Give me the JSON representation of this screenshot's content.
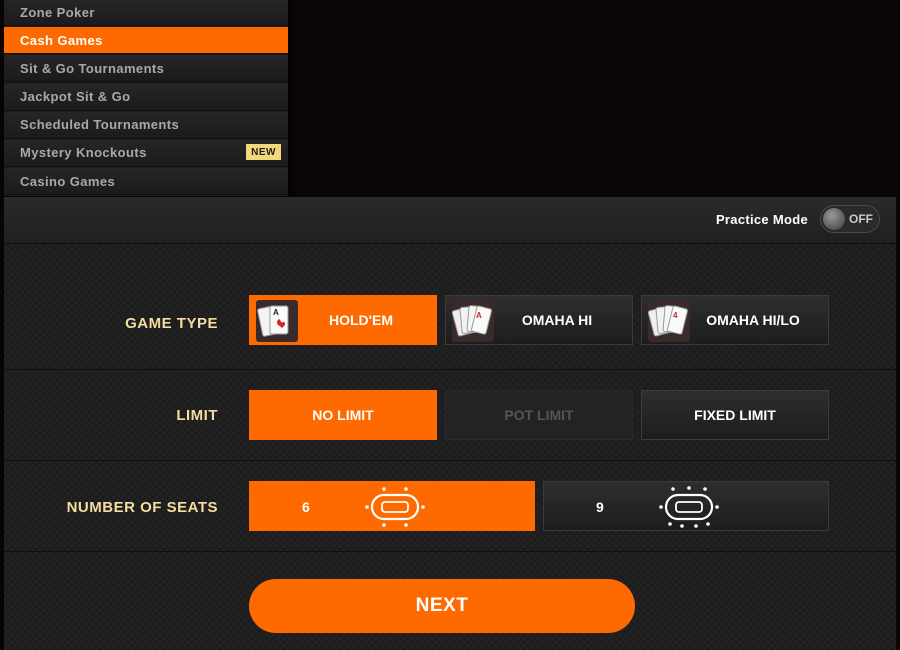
{
  "menu": {
    "items": [
      {
        "label": "Zone Poker"
      },
      {
        "label": "Cash Games"
      },
      {
        "label": "Sit & Go Tournaments"
      },
      {
        "label": "Jackpot Sit & Go"
      },
      {
        "label": "Scheduled Tournaments"
      },
      {
        "label": "Mystery Knockouts",
        "badge": "NEW"
      },
      {
        "label": "Casino Games"
      }
    ],
    "active_index": 1
  },
  "header": {
    "practice_mode_label": "Practice Mode",
    "practice_toggle_state": "OFF"
  },
  "game_type": {
    "label": "GAME TYPE",
    "options": [
      "HOLD'EM",
      "OMAHA HI",
      "OMAHA HI/LO"
    ],
    "selected": "HOLD'EM"
  },
  "limit": {
    "label": "LIMIT",
    "options": [
      "NO LIMIT",
      "POT LIMIT",
      "FIXED LIMIT"
    ],
    "selected": "NO LIMIT",
    "disabled": [
      "POT LIMIT"
    ]
  },
  "seats": {
    "label": "NUMBER OF SEATS",
    "options": [
      "6",
      "9"
    ],
    "selected": "6"
  },
  "next_button": "NEXT",
  "colors": {
    "accent": "#ff6a00",
    "label_text": "#f5dca0",
    "badge": "#f5d77b",
    "background": "#0b0404"
  },
  "icons": [
    "playing-cards-icon",
    "poker-table-6-seat-icon",
    "poker-table-9-seat-icon",
    "toggle-knob-icon"
  ]
}
